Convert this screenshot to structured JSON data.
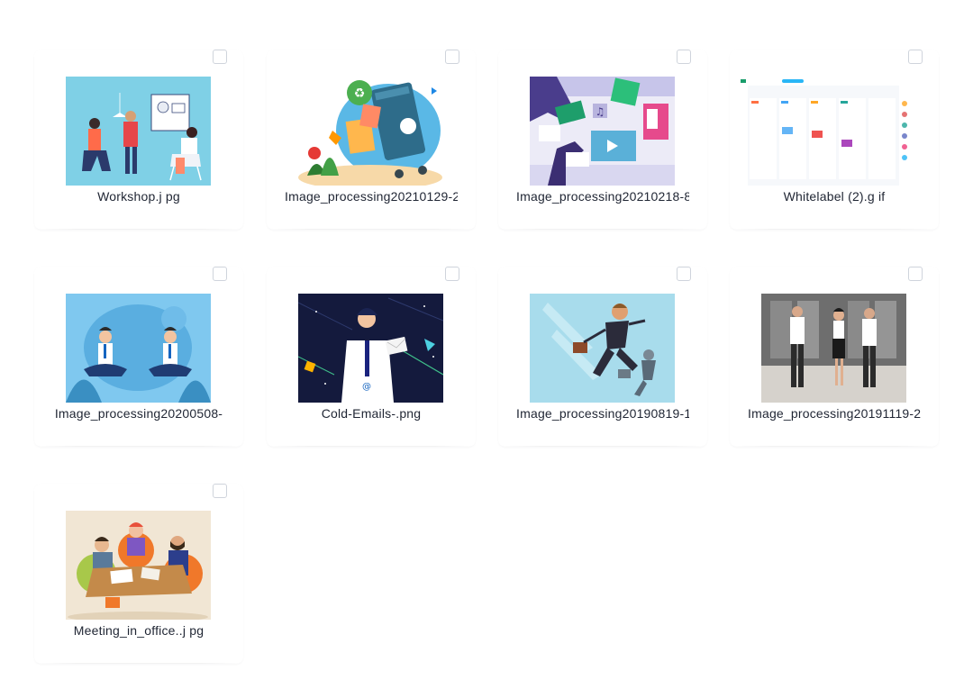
{
  "files": [
    {
      "name": "Workshop.j pg",
      "thumb": "workshop-illustration"
    },
    {
      "name": "Image_processing20210129-2",
      "thumb": "recycle-bin-illustration"
    },
    {
      "name": "Image_processing20210218-8",
      "thumb": "gallery-hands-illustration"
    },
    {
      "name": "Whitelabel (2).g if",
      "thumb": "dashboard-screenshot"
    },
    {
      "name": "Image_processing20200508-",
      "thumb": "meditation-illustration"
    },
    {
      "name": "Cold-Emails-.png",
      "thumb": "space-email-illustration"
    },
    {
      "name": "Image_processing20190819-1",
      "thumb": "running-businessman-illustration"
    },
    {
      "name": "Image_processing20191119-2",
      "thumb": "office-people-illustration"
    },
    {
      "name": "Meeting_in_office..j pg",
      "thumb": "meeting-table-illustration"
    }
  ],
  "colors": {
    "checkbox_border": "#cfd4dc",
    "filename_text": "#1f2533",
    "background": "#ffffff"
  }
}
